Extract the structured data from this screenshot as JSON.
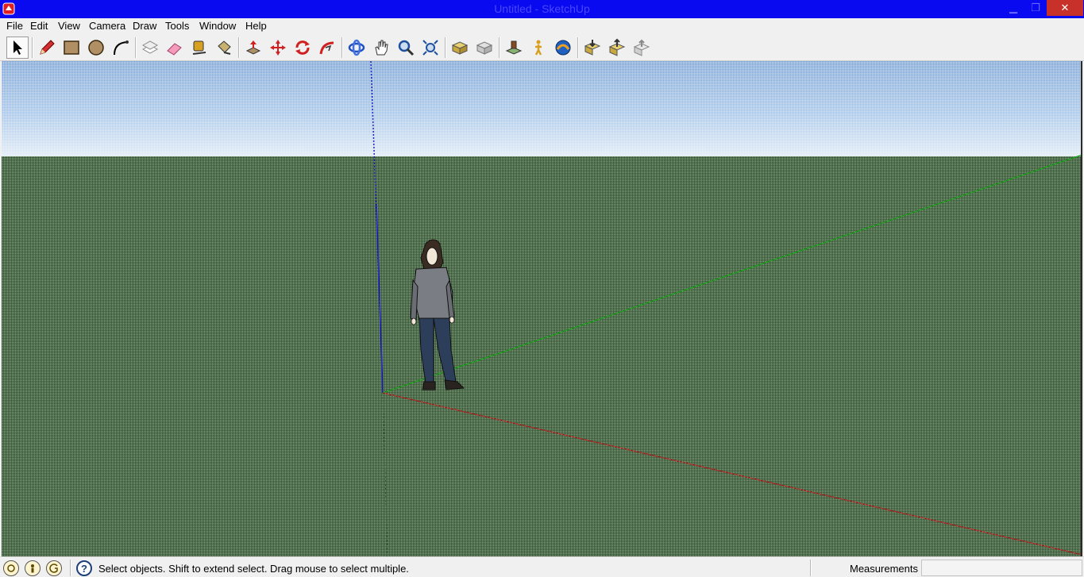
{
  "window": {
    "title": "Untitled - SketchUp",
    "minimize_glyph": "▁",
    "maximize_glyph": "❐",
    "close_glyph": "✕"
  },
  "menu": [
    "File",
    "Edit",
    "View",
    "Camera",
    "Draw",
    "Tools",
    "Window",
    "Help"
  ],
  "toolbar": {
    "tools": [
      "select-icon",
      "pencil-icon",
      "rectangle-icon",
      "circle-icon",
      "arc-icon",
      "make-component-icon",
      "eraser-icon",
      "tape-measure-icon",
      "paint-bucket-icon",
      "push-pull-icon",
      "move-icon",
      "rotate-icon",
      "follow-me-icon",
      "orbit-icon",
      "pan-icon",
      "zoom-icon",
      "zoom-extents-icon",
      "previous-view-icon",
      "next-view-icon",
      "position-camera-icon",
      "walk-icon",
      "look-around-icon",
      "get-models-icon",
      "share-model-icon",
      "share-component-icon"
    ]
  },
  "viewport": {
    "sky_color": "#9cbfe6",
    "ground_color": "#86ac82",
    "red_axis_color": "#b02020",
    "green_axis_color": "#18a018",
    "blue_axis_color": "#2020c0"
  },
  "status": {
    "geo_icon": "geo-location-icon",
    "credits_icon": "credits-icon",
    "signin_icon": "sign-in-icon",
    "help_glyph": "?",
    "message": "Select objects. Shift to extend select. Drag mouse to select multiple.",
    "measurements_label": "Measurements",
    "measurements_value": ""
  }
}
